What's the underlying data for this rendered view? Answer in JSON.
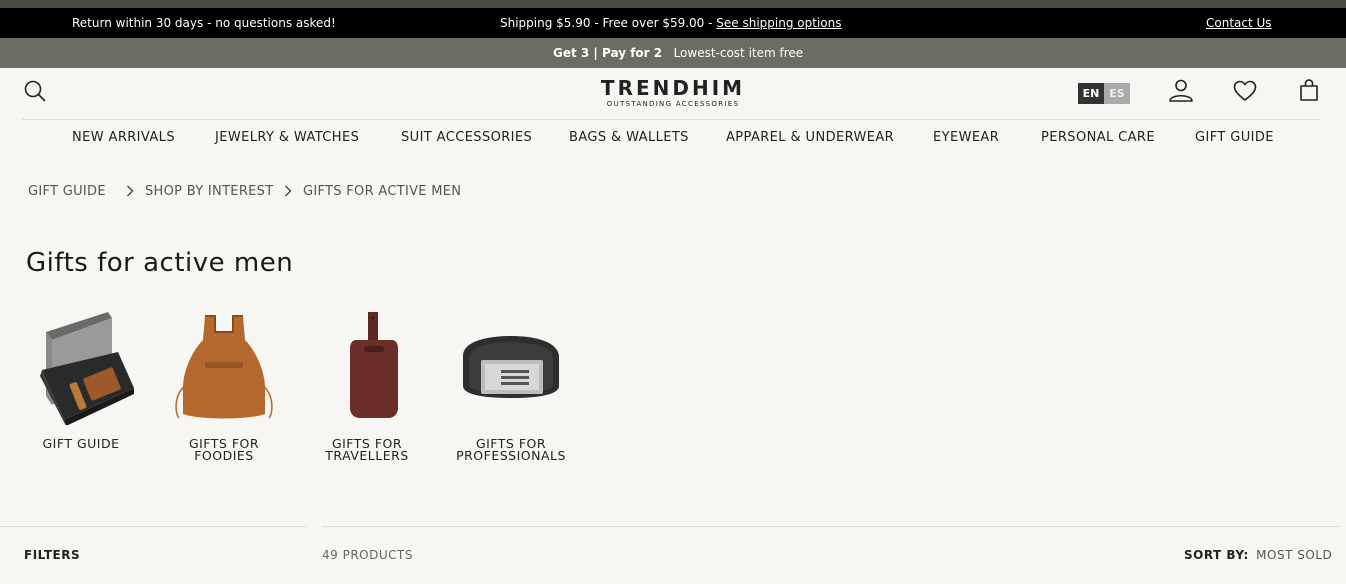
{
  "promo_bar": {
    "left": "Return within 30 days - no questions asked!",
    "center_text": "Shipping $5.90 - Free over $59.00 -",
    "center_link": "See shipping options",
    "right": "Contact Us"
  },
  "offer_bar": {
    "bold": "Get 3 | Pay for 2",
    "text": "Lowest-cost item free"
  },
  "logo": {
    "name": "TRENDHIM",
    "tagline": "OUTSTANDING ACCESSORIES"
  },
  "languages": [
    "EN",
    "ES"
  ],
  "nav": [
    "NEW ARRIVALS",
    "JEWELRY & WATCHES",
    "SUIT ACCESSORIES",
    "BAGS & WALLETS",
    "APPAREL & UNDERWEAR",
    "EYEWEAR",
    "PERSONAL CARE",
    "GIFT GUIDE"
  ],
  "breadcrumb": [
    "GIFT GUIDE",
    "SHOP BY INTEREST",
    "GIFTS FOR ACTIVE MEN"
  ],
  "page_title": "Gifts for active men",
  "categories": [
    {
      "line1": "GIFT GUIDE",
      "line2": ""
    },
    {
      "line1": "GIFTS FOR",
      "line2": "FOODIES"
    },
    {
      "line1": "GIFTS FOR",
      "line2": "TRAVELLERS"
    },
    {
      "line1": "GIFTS FOR",
      "line2": "PROFESSIONALS"
    }
  ],
  "toolbar": {
    "filters": "FILTERS",
    "count": "49 PRODUCTS",
    "sort_label": "SORT BY:",
    "sort_value": "MOST SOLD"
  }
}
